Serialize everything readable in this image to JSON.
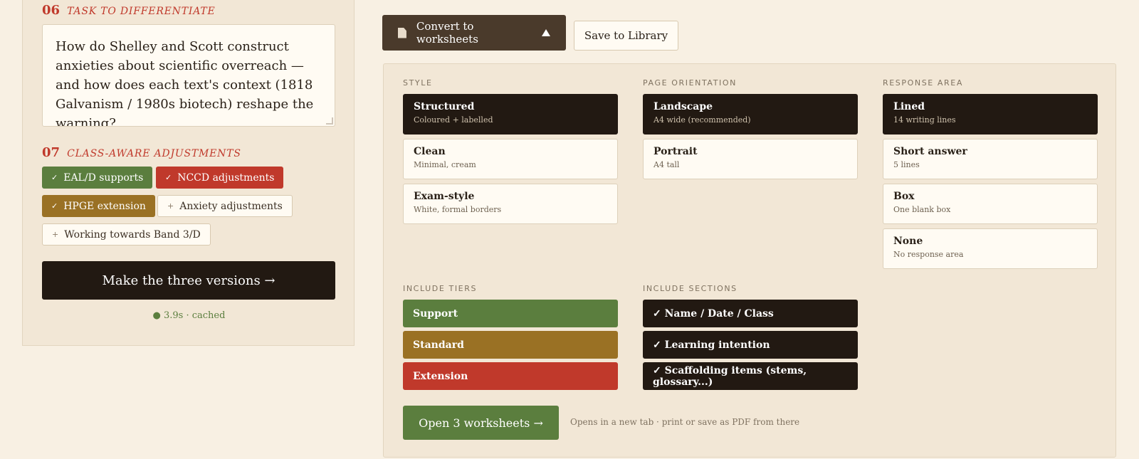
{
  "left": {
    "task_section": {
      "number": "06",
      "title": "TASK TO DIFFERENTIATE"
    },
    "task_text": "How do Shelley and Scott construct anxieties about scientific overreach — and how does each text's context (1818 Galvanism / 1980s biotech) reshape the warning?",
    "adjust_section": {
      "number": "07",
      "title": "CLASS-AWARE ADJUSTMENTS"
    },
    "chips": [
      {
        "mark": "✓",
        "label": "EAL/D supports"
      },
      {
        "mark": "✓",
        "label": "NCCD adjustments"
      },
      {
        "mark": "✓",
        "label": "HPGE extension"
      },
      {
        "mark": "+",
        "label": "Anxiety adjustments"
      },
      {
        "mark": "+",
        "label": "Working towards Band 3/D"
      }
    ],
    "make_button": "Make the three versions →",
    "status": "● 3.9s · cached"
  },
  "toolbar": {
    "convert_label": "Convert to worksheets",
    "save_label": "Save to Library"
  },
  "options": {
    "style": {
      "label": "STYLE",
      "items": [
        {
          "title": "Structured",
          "sub": "Coloured + labelled"
        },
        {
          "title": "Clean",
          "sub": "Minimal, cream"
        },
        {
          "title": "Exam-style",
          "sub": "White, formal borders"
        }
      ]
    },
    "orientation": {
      "label": "PAGE ORIENTATION",
      "items": [
        {
          "title": "Landscape",
          "sub": "A4 wide (recommended)"
        },
        {
          "title": "Portrait",
          "sub": "A4 tall"
        }
      ]
    },
    "response": {
      "label": "RESPONSE AREA",
      "items": [
        {
          "title": "Lined",
          "sub": "14 writing lines"
        },
        {
          "title": "Short answer",
          "sub": "5 lines"
        },
        {
          "title": "Box",
          "sub": "One blank box"
        },
        {
          "title": "None",
          "sub": "No response area"
        }
      ]
    },
    "tiers": {
      "label": "INCLUDE TIERS",
      "items": [
        "Support",
        "Standard",
        "Extension"
      ]
    },
    "sections": {
      "label": "INCLUDE SECTIONS",
      "items": [
        "✓ Name / Date / Class",
        "✓ Learning intention",
        "✓ Scaffolding items (stems, glossary...)"
      ]
    },
    "open_button": "Open 3 worksheets →",
    "open_note": "Opens in a new tab · print or save as PDF from there"
  },
  "colors": {
    "accent_red": "#c0392b",
    "green": "#5b7e3e",
    "amber": "#9a7124",
    "dark": "#221912",
    "background": "#f8f0e3"
  }
}
